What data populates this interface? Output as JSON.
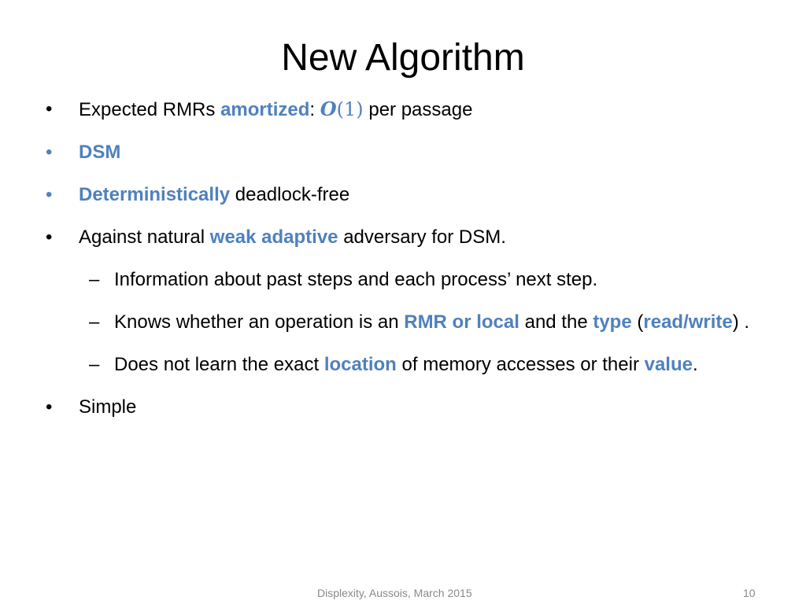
{
  "slide": {
    "title": "New Algorithm",
    "accent_color": "#4f81bd",
    "bullets": [
      {
        "level": 1,
        "segments": [
          {
            "text": "Expected RMRs ",
            "style": "plain"
          },
          {
            "text": "amortized",
            "style": "highlight"
          },
          {
            "text": ": ",
            "style": "plain"
          },
          {
            "text": "O(1)",
            "style": "math"
          },
          {
            "text": " per passage",
            "style": "plain"
          }
        ]
      },
      {
        "level": 1,
        "marker_color": "blue",
        "segments": [
          {
            "text": "DSM",
            "style": "highlight"
          }
        ]
      },
      {
        "level": 1,
        "marker_color": "blue",
        "segments": [
          {
            "text": "Deterministically",
            "style": "highlight"
          },
          {
            "text": " deadlock-free",
            "style": "plain"
          }
        ]
      },
      {
        "level": 1,
        "segments": [
          {
            "text": "Against natural ",
            "style": "plain"
          },
          {
            "text": "weak adaptive",
            "style": "highlight"
          },
          {
            "text": " adversary for DSM.",
            "style": "plain"
          }
        ]
      },
      {
        "level": 2,
        "segments": [
          {
            "text": "Information about past steps and each process’ next step.",
            "style": "plain"
          }
        ]
      },
      {
        "level": 2,
        "segments": [
          {
            "text": "Knows whether an operation is an ",
            "style": "plain"
          },
          {
            "text": "RMR or local",
            "style": "highlight"
          },
          {
            "text": " and the ",
            "style": "plain"
          },
          {
            "text": "type",
            "style": "highlight"
          },
          {
            "text": " (",
            "style": "plain"
          },
          {
            "text": "read/write",
            "style": "highlight"
          },
          {
            "text": ") .",
            "style": "plain"
          }
        ]
      },
      {
        "level": 2,
        "segments": [
          {
            "text": "Does not learn the exact ",
            "style": "plain"
          },
          {
            "text": "location",
            "style": "highlight"
          },
          {
            "text": " of memory accesses or their ",
            "style": "plain"
          },
          {
            "text": "value",
            "style": "highlight"
          },
          {
            "text": ".",
            "style": "plain"
          }
        ]
      },
      {
        "level": 1,
        "segments": [
          {
            "text": "Simple",
            "style": "plain"
          }
        ]
      }
    ],
    "markers": {
      "level1": "•",
      "level2": "–"
    },
    "footer": "Displexity, Aussois, March 2015",
    "page_number": "10"
  }
}
